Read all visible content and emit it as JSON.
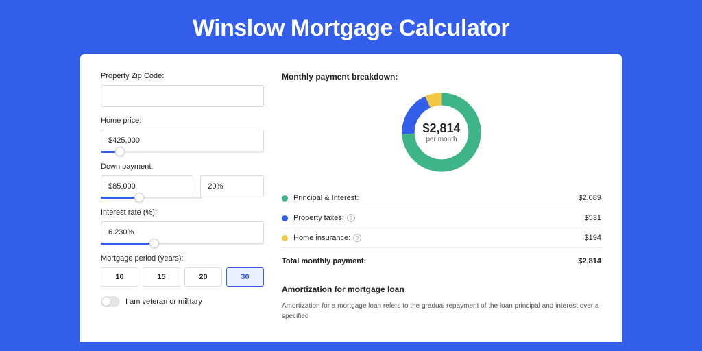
{
  "title": "Winslow Mortgage Calculator",
  "form": {
    "zip_label": "Property Zip Code:",
    "zip_value": "",
    "price_label": "Home price:",
    "price_value": "$425,000",
    "price_slider_fill_pct": 9,
    "down_label": "Down payment:",
    "down_value": "$85,000",
    "down_pct_value": "20%",
    "down_slider_fill_pct": 20,
    "rate_label": "Interest rate (%):",
    "rate_value": "6.230%",
    "rate_slider_fill_pct": 30,
    "period_label": "Mortgage period (years):",
    "periods": [
      "10",
      "15",
      "20",
      "30"
    ],
    "active_period": "30",
    "veteran_label": "I am veteran or military"
  },
  "breakdown": {
    "title": "Monthly payment breakdown:",
    "total_value": "$2,814",
    "per_month": "per month",
    "items": [
      {
        "label": "Principal & Interest:",
        "value": "$2,089",
        "color": "#3eb489",
        "has_help": false
      },
      {
        "label": "Property taxes:",
        "value": "$531",
        "color": "#335eea",
        "has_help": true
      },
      {
        "label": "Home insurance:",
        "value": "$194",
        "color": "#f2c744",
        "has_help": true
      }
    ],
    "total_label": "Total monthly payment:",
    "total_row_value": "$2,814"
  },
  "chart_data": {
    "type": "pie",
    "title": "Monthly payment breakdown",
    "series": [
      {
        "name": "Principal & Interest",
        "value": 2089,
        "color": "#3eb489"
      },
      {
        "name": "Property taxes",
        "value": 531,
        "color": "#335eea"
      },
      {
        "name": "Home insurance",
        "value": 194,
        "color": "#f2c744"
      }
    ],
    "total": 2814,
    "center_label": "$2,814",
    "center_sublabel": "per month"
  },
  "amort": {
    "title": "Amortization for mortgage loan",
    "text": "Amortization for a mortgage loan refers to the gradual repayment of the loan principal and interest over a specified"
  }
}
